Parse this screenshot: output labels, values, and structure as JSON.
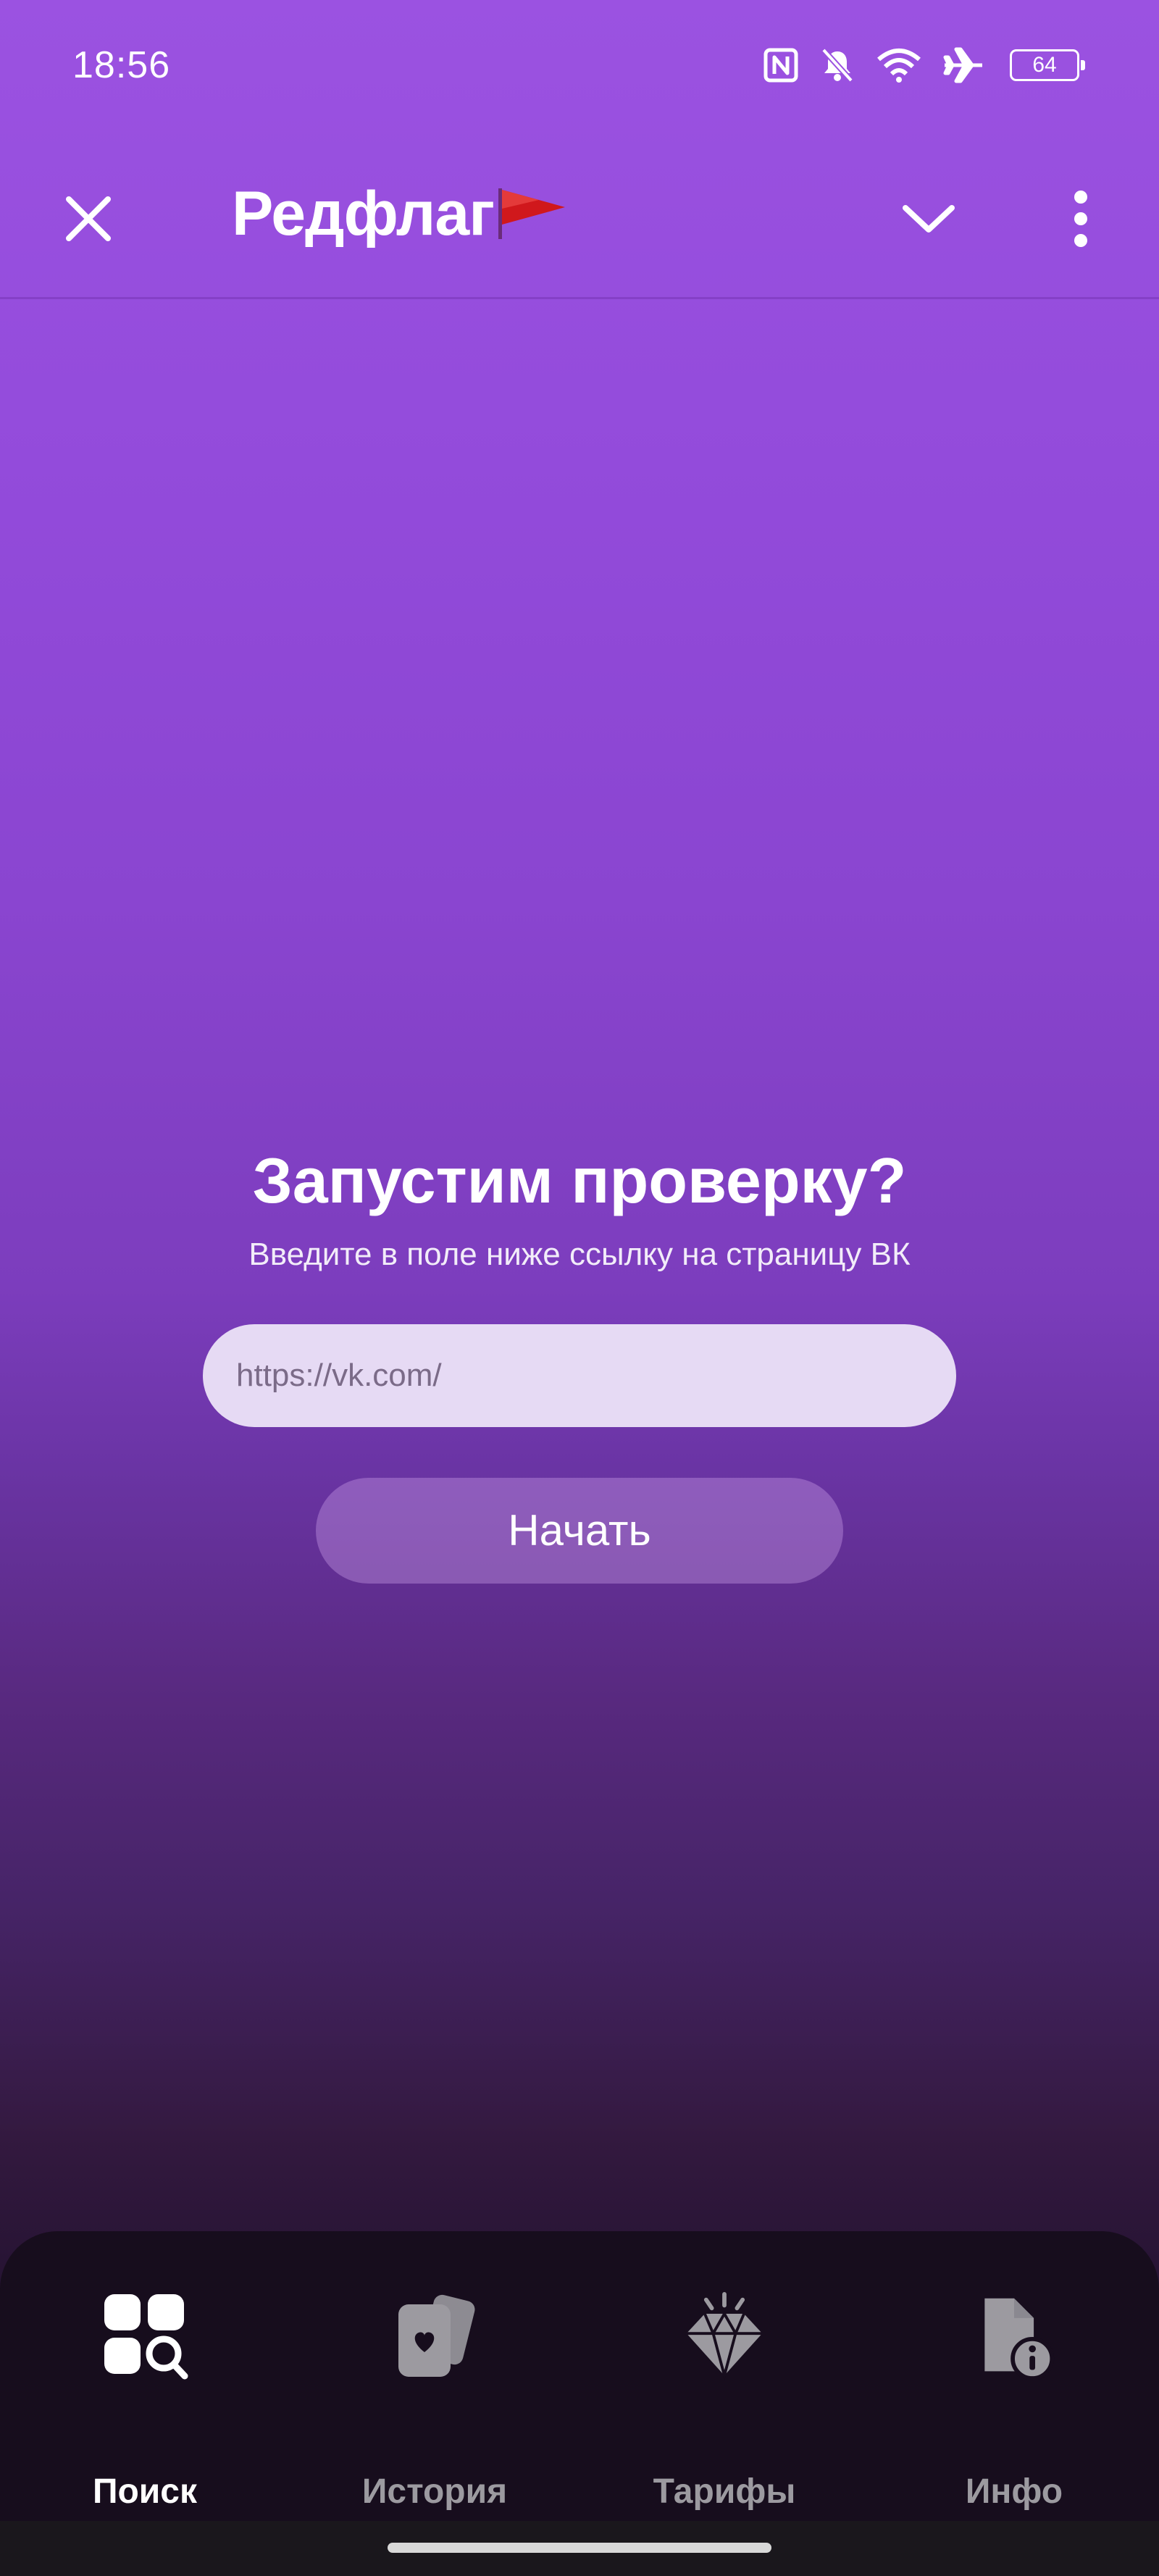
{
  "status_bar": {
    "time": "18:56",
    "battery_level": "64",
    "icons": [
      "nfc-icon",
      "bell-off-icon",
      "wifi-icon",
      "airplane-icon",
      "battery-icon"
    ]
  },
  "toolbar": {
    "title": "Редфлаг",
    "title_emoji": "flag-icon",
    "close_icon": "close-icon",
    "expand_icon": "chevron-down-icon",
    "menu_icon": "more-vertical-icon"
  },
  "main": {
    "title": "Запустим проверку?",
    "subtitle": "Введите в поле ниже ссылку на страницу ВК",
    "url_input": {
      "value": "",
      "placeholder": "https://vk.com/"
    },
    "start_button": "Начать"
  },
  "bottom_nav": {
    "items": [
      {
        "label": "Поиск",
        "icon": "search-grid-icon",
        "active": true
      },
      {
        "label": "История",
        "icon": "history-cards-icon",
        "active": false
      },
      {
        "label": "Тарифы",
        "icon": "diamond-icon",
        "active": false
      },
      {
        "label": "Инфо",
        "icon": "info-document-icon",
        "active": false
      }
    ]
  },
  "colors": {
    "background_top": "#9b52e1",
    "background_bottom": "#170d1c",
    "input_background": "#e6daf4",
    "nav_background": "#170d1d",
    "nav_active": "#ffffff",
    "nav_inactive": "#9c9aa0"
  }
}
